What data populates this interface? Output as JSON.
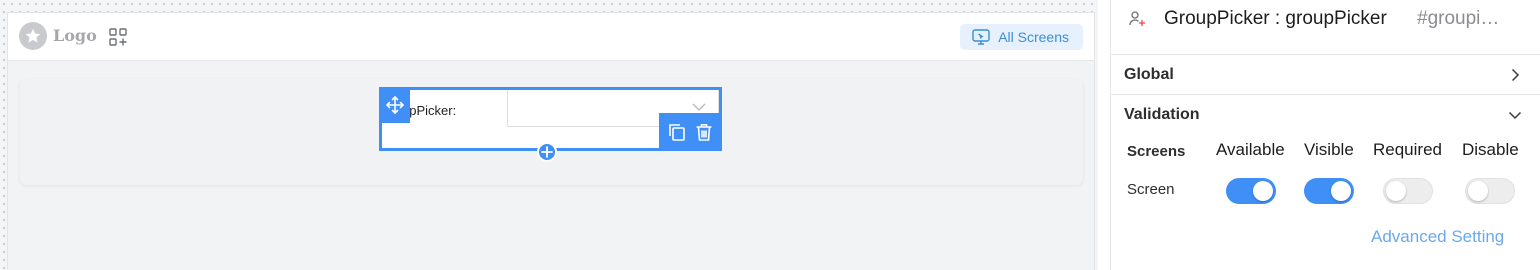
{
  "page_header": {
    "logo_text": "Logo",
    "all_screens_label": "All Screens"
  },
  "component": {
    "label": "upPicker:"
  },
  "panel": {
    "title": "GroupPicker : groupPicker",
    "id": "#groupi…",
    "sections": [
      {
        "title": "Global",
        "expanded": false
      },
      {
        "title": "Validation",
        "expanded": true
      }
    ],
    "screens_table": {
      "headers": [
        "Screens",
        "Available",
        "Visible",
        "Required",
        "Disable"
      ],
      "rows": [
        {
          "label": "Screen",
          "available": true,
          "visible": true,
          "required": false,
          "disable": false
        }
      ]
    },
    "advanced_setting_label": "Advanced Setting"
  },
  "colors": {
    "accent": "#3f8ff7",
    "link": "#6aa9ea",
    "pill_bg": "#e6f1fd"
  },
  "icons": [
    "star-icon",
    "apps-add-icon",
    "screen-icon",
    "move-icon",
    "copy-icon",
    "delete-icon",
    "plus-icon",
    "chevron-down-icon",
    "group-user-icon",
    "chevron-right-icon"
  ]
}
